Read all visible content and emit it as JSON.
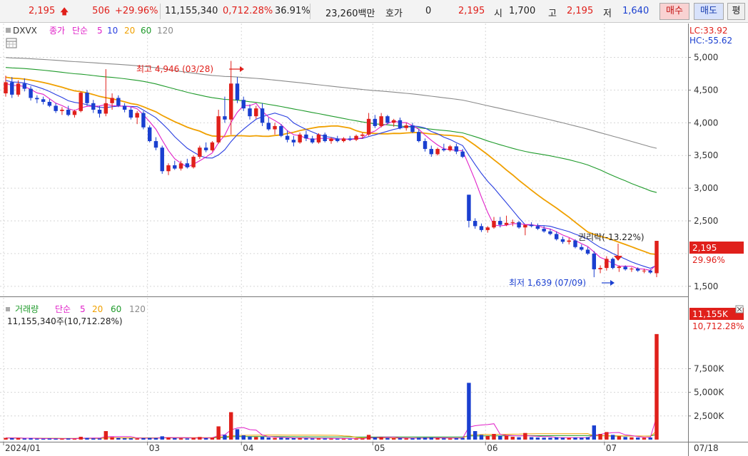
{
  "toolbar": {
    "price": "2,195",
    "change": "506",
    "change_rate": "+29.96%",
    "volume": "11,155,340",
    "volume_ratio": "0,712.28%",
    "turnover": "36.91%",
    "amount": "23,260백만",
    "quote_label": "호가",
    "quote_value": "0",
    "quote_price": "2,195",
    "open_label": "시",
    "open_value": "1,700",
    "high_label": "고",
    "high_value": "2,195",
    "low_label": "저",
    "low_value": "1,640",
    "buy_label": "매수",
    "sell_label": "매도",
    "avg_label": "평"
  },
  "price_panel": {
    "symbol": "DXVX",
    "indicator": "종가",
    "ma_type": "단순",
    "ma_periods": [
      "5",
      "10",
      "20",
      "60",
      "120"
    ],
    "lc": "LC:33.92",
    "hc": "HC:-55.62",
    "high_annotation": "최고 4,946 (03/28)",
    "low_annotation": "최저 1,639 (07/09)",
    "rights_annotation": "권리락(-13.22%)",
    "current_price_tag": "2,195",
    "current_change_tag": "29.96%",
    "y_ticks": [
      "5,000",
      "4,500",
      "4,000",
      "3,500",
      "3,000",
      "2,500",
      "1,500"
    ]
  },
  "volume_panel": {
    "title": "거래량",
    "ma_type": "단순",
    "ma_periods": [
      "5",
      "20",
      "60",
      "120"
    ],
    "info": "11,155,340주(10,712.28%)",
    "current_tag": "11,155K",
    "current_ratio_tag": "10,712.28%",
    "y_ticks": [
      "7,500K",
      "5,000K",
      "2,500K"
    ]
  },
  "x_axis": {
    "labels": [
      "2024/01",
      "03",
      "04",
      "05",
      "06",
      "07"
    ],
    "right_label": "07/18"
  },
  "colors": {
    "up": "#e0201b",
    "down": "#1a3fd0",
    "ma5": "#e020c8",
    "ma10": "#2a3fe0",
    "ma20": "#f0a000",
    "ma60": "#1e9a2a",
    "ma120": "#8a8a8a"
  },
  "chart_data": {
    "type": "candlestick",
    "title": "DXVX",
    "y_range": [
      1400,
      5300
    ],
    "volume_range_thousands": [
      0,
      12500
    ],
    "candles": [
      {
        "o": 4450,
        "h": 4720,
        "l": 4400,
        "c": 4620,
        "v": 180
      },
      {
        "o": 4620,
        "h": 4700,
        "l": 4380,
        "c": 4430,
        "v": 150
      },
      {
        "o": 4430,
        "h": 4650,
        "l": 4400,
        "c": 4600,
        "v": 160
      },
      {
        "o": 4600,
        "h": 4680,
        "l": 4480,
        "c": 4520,
        "v": 120
      },
      {
        "o": 4520,
        "h": 4560,
        "l": 4340,
        "c": 4380,
        "v": 140
      },
      {
        "o": 4380,
        "h": 4420,
        "l": 4300,
        "c": 4360,
        "v": 100
      },
      {
        "o": 4360,
        "h": 4400,
        "l": 4280,
        "c": 4320,
        "v": 90
      },
      {
        "o": 4320,
        "h": 4360,
        "l": 4240,
        "c": 4260,
        "v": 110
      },
      {
        "o": 4260,
        "h": 4300,
        "l": 4150,
        "c": 4180,
        "v": 100
      },
      {
        "o": 4180,
        "h": 4240,
        "l": 4120,
        "c": 4200,
        "v": 90
      },
      {
        "o": 4200,
        "h": 4260,
        "l": 4100,
        "c": 4120,
        "v": 120
      },
      {
        "o": 4120,
        "h": 4200,
        "l": 4080,
        "c": 4180,
        "v": 90
      },
      {
        "o": 4180,
        "h": 4480,
        "l": 4160,
        "c": 4460,
        "v": 300
      },
      {
        "o": 4460,
        "h": 4500,
        "l": 4260,
        "c": 4300,
        "v": 180
      },
      {
        "o": 4300,
        "h": 4350,
        "l": 4150,
        "c": 4200,
        "v": 130
      },
      {
        "o": 4200,
        "h": 4260,
        "l": 4080,
        "c": 4140,
        "v": 120
      },
      {
        "o": 4140,
        "h": 4820,
        "l": 4100,
        "c": 4300,
        "v": 900
      },
      {
        "o": 4300,
        "h": 4450,
        "l": 4200,
        "c": 4380,
        "v": 260
      },
      {
        "o": 4380,
        "h": 4420,
        "l": 4240,
        "c": 4260,
        "v": 180
      },
      {
        "o": 4260,
        "h": 4300,
        "l": 4160,
        "c": 4200,
        "v": 140
      },
      {
        "o": 4200,
        "h": 4240,
        "l": 4050,
        "c": 4080,
        "v": 140
      },
      {
        "o": 4080,
        "h": 4180,
        "l": 3980,
        "c": 4150,
        "v": 120
      },
      {
        "o": 4150,
        "h": 4180,
        "l": 3900,
        "c": 3930,
        "v": 160
      },
      {
        "o": 3930,
        "h": 3960,
        "l": 3700,
        "c": 3720,
        "v": 180
      },
      {
        "o": 3720,
        "h": 3780,
        "l": 3580,
        "c": 3620,
        "v": 170
      },
      {
        "o": 3620,
        "h": 3650,
        "l": 3220,
        "c": 3260,
        "v": 350
      },
      {
        "o": 3260,
        "h": 3380,
        "l": 3200,
        "c": 3350,
        "v": 220
      },
      {
        "o": 3350,
        "h": 3420,
        "l": 3280,
        "c": 3300,
        "v": 150
      },
      {
        "o": 3300,
        "h": 3420,
        "l": 3270,
        "c": 3380,
        "v": 140
      },
      {
        "o": 3380,
        "h": 3450,
        "l": 3300,
        "c": 3320,
        "v": 120
      },
      {
        "o": 3320,
        "h": 3500,
        "l": 3300,
        "c": 3480,
        "v": 180
      },
      {
        "o": 3480,
        "h": 3650,
        "l": 3450,
        "c": 3620,
        "v": 280
      },
      {
        "o": 3620,
        "h": 3700,
        "l": 3550,
        "c": 3580,
        "v": 160
      },
      {
        "o": 3580,
        "h": 3720,
        "l": 3560,
        "c": 3700,
        "v": 200
      },
      {
        "o": 3700,
        "h": 4200,
        "l": 3680,
        "c": 4100,
        "v": 1400
      },
      {
        "o": 4100,
        "h": 4400,
        "l": 4000,
        "c": 4050,
        "v": 500
      },
      {
        "o": 4050,
        "h": 4946,
        "l": 3820,
        "c": 4600,
        "v": 2900
      },
      {
        "o": 4600,
        "h": 4700,
        "l": 4300,
        "c": 4350,
        "v": 1100
      },
      {
        "o": 4350,
        "h": 4400,
        "l": 4180,
        "c": 4220,
        "v": 450
      },
      {
        "o": 4220,
        "h": 4280,
        "l": 4050,
        "c": 4100,
        "v": 320
      },
      {
        "o": 4100,
        "h": 4260,
        "l": 4060,
        "c": 4220,
        "v": 280
      },
      {
        "o": 4220,
        "h": 4300,
        "l": 3950,
        "c": 4000,
        "v": 300
      },
      {
        "o": 4000,
        "h": 4080,
        "l": 3880,
        "c": 3900,
        "v": 220
      },
      {
        "o": 3900,
        "h": 4000,
        "l": 3820,
        "c": 3950,
        "v": 180
      },
      {
        "o": 3950,
        "h": 3980,
        "l": 3780,
        "c": 3800,
        "v": 200
      },
      {
        "o": 3800,
        "h": 3880,
        "l": 3700,
        "c": 3740,
        "v": 160
      },
      {
        "o": 3740,
        "h": 3800,
        "l": 3640,
        "c": 3700,
        "v": 150
      },
      {
        "o": 3700,
        "h": 3850,
        "l": 3680,
        "c": 3820,
        "v": 170
      },
      {
        "o": 3820,
        "h": 3880,
        "l": 3720,
        "c": 3760,
        "v": 140
      },
      {
        "o": 3760,
        "h": 3800,
        "l": 3680,
        "c": 3700,
        "v": 120
      },
      {
        "o": 3700,
        "h": 3840,
        "l": 3680,
        "c": 3820,
        "v": 150
      },
      {
        "o": 3820,
        "h": 3850,
        "l": 3700,
        "c": 3720,
        "v": 130
      },
      {
        "o": 3720,
        "h": 3780,
        "l": 3680,
        "c": 3760,
        "v": 110
      },
      {
        "o": 3760,
        "h": 3800,
        "l": 3700,
        "c": 3720,
        "v": 100
      },
      {
        "o": 3720,
        "h": 3780,
        "l": 3700,
        "c": 3760,
        "v": 100
      },
      {
        "o": 3760,
        "h": 3800,
        "l": 3720,
        "c": 3740,
        "v": 90
      },
      {
        "o": 3740,
        "h": 3820,
        "l": 3720,
        "c": 3800,
        "v": 110
      },
      {
        "o": 3800,
        "h": 3850,
        "l": 3760,
        "c": 3820,
        "v": 120
      },
      {
        "o": 3820,
        "h": 4150,
        "l": 3800,
        "c": 4060,
        "v": 500
      },
      {
        "o": 4060,
        "h": 4120,
        "l": 3920,
        "c": 3950,
        "v": 220
      },
      {
        "o": 3950,
        "h": 4150,
        "l": 3930,
        "c": 4100,
        "v": 250
      },
      {
        "o": 4100,
        "h": 4120,
        "l": 3980,
        "c": 4000,
        "v": 180
      },
      {
        "o": 4000,
        "h": 4060,
        "l": 3940,
        "c": 4040,
        "v": 150
      },
      {
        "o": 4040,
        "h": 4080,
        "l": 3900,
        "c": 3920,
        "v": 160
      },
      {
        "o": 3920,
        "h": 4000,
        "l": 3880,
        "c": 3960,
        "v": 130
      },
      {
        "o": 3960,
        "h": 4000,
        "l": 3840,
        "c": 3860,
        "v": 140
      },
      {
        "o": 3860,
        "h": 3900,
        "l": 3700,
        "c": 3720,
        "v": 200
      },
      {
        "o": 3720,
        "h": 3760,
        "l": 3560,
        "c": 3600,
        "v": 210
      },
      {
        "o": 3600,
        "h": 3650,
        "l": 3480,
        "c": 3520,
        "v": 220
      },
      {
        "o": 3520,
        "h": 3620,
        "l": 3500,
        "c": 3600,
        "v": 160
      },
      {
        "o": 3600,
        "h": 3680,
        "l": 3560,
        "c": 3580,
        "v": 140
      },
      {
        "o": 3580,
        "h": 3660,
        "l": 3560,
        "c": 3640,
        "v": 120
      },
      {
        "o": 3640,
        "h": 3680,
        "l": 3520,
        "c": 3560,
        "v": 150
      },
      {
        "o": 3560,
        "h": 3600,
        "l": 3460,
        "c": 3480,
        "v": 170
      },
      {
        "o": 2900,
        "h": 2900,
        "l": 2400,
        "c": 2500,
        "v": 6000
      },
      {
        "o": 2500,
        "h": 2540,
        "l": 2380,
        "c": 2420,
        "v": 900
      },
      {
        "o": 2420,
        "h": 2460,
        "l": 2330,
        "c": 2360,
        "v": 500
      },
      {
        "o": 2360,
        "h": 2420,
        "l": 2320,
        "c": 2400,
        "v": 380
      },
      {
        "o": 2400,
        "h": 2560,
        "l": 2380,
        "c": 2500,
        "v": 600
      },
      {
        "o": 2500,
        "h": 2560,
        "l": 2400,
        "c": 2440,
        "v": 400
      },
      {
        "o": 2440,
        "h": 2580,
        "l": 2420,
        "c": 2470,
        "v": 420
      },
      {
        "o": 2470,
        "h": 2520,
        "l": 2420,
        "c": 2480,
        "v": 300
      },
      {
        "o": 2480,
        "h": 2500,
        "l": 2380,
        "c": 2400,
        "v": 250
      },
      {
        "o": 2400,
        "h": 2420,
        "l": 2280,
        "c": 2440,
        "v": 700
      },
      {
        "o": 2440,
        "h": 2480,
        "l": 2400,
        "c": 2420,
        "v": 260
      },
      {
        "o": 2420,
        "h": 2460,
        "l": 2360,
        "c": 2380,
        "v": 220
      },
      {
        "o": 2380,
        "h": 2420,
        "l": 2320,
        "c": 2340,
        "v": 200
      },
      {
        "o": 2340,
        "h": 2380,
        "l": 2280,
        "c": 2300,
        "v": 200
      },
      {
        "o": 2300,
        "h": 2340,
        "l": 2200,
        "c": 2220,
        "v": 240
      },
      {
        "o": 2220,
        "h": 2260,
        "l": 2150,
        "c": 2180,
        "v": 200
      },
      {
        "o": 2180,
        "h": 2240,
        "l": 2140,
        "c": 2200,
        "v": 180
      },
      {
        "o": 2200,
        "h": 2220,
        "l": 2080,
        "c": 2100,
        "v": 220
      },
      {
        "o": 2100,
        "h": 2140,
        "l": 2040,
        "c": 2060,
        "v": 200
      },
      {
        "o": 2060,
        "h": 2100,
        "l": 1980,
        "c": 2000,
        "v": 260
      },
      {
        "o": 2000,
        "h": 2040,
        "l": 1639,
        "c": 1760,
        "v": 1500
      },
      {
        "o": 1760,
        "h": 1820,
        "l": 1700,
        "c": 1780,
        "v": 600
      },
      {
        "o": 1780,
        "h": 1960,
        "l": 1740,
        "c": 1920,
        "v": 800
      },
      {
        "o": 1920,
        "h": 1940,
        "l": 1760,
        "c": 1780,
        "v": 500
      },
      {
        "o": 1780,
        "h": 1820,
        "l": 1720,
        "c": 1800,
        "v": 350
      },
      {
        "o": 1800,
        "h": 1820,
        "l": 1740,
        "c": 1760,
        "v": 280
      },
      {
        "o": 1760,
        "h": 1790,
        "l": 1720,
        "c": 1770,
        "v": 240
      },
      {
        "o": 1770,
        "h": 1790,
        "l": 1720,
        "c": 1740,
        "v": 220
      },
      {
        "o": 1740,
        "h": 1770,
        "l": 1700,
        "c": 1740,
        "v": 200
      },
      {
        "o": 1740,
        "h": 1760,
        "l": 1690,
        "c": 1710,
        "v": 220
      },
      {
        "o": 1700,
        "h": 2195,
        "l": 1640,
        "c": 2195,
        "v": 11155
      }
    ]
  }
}
